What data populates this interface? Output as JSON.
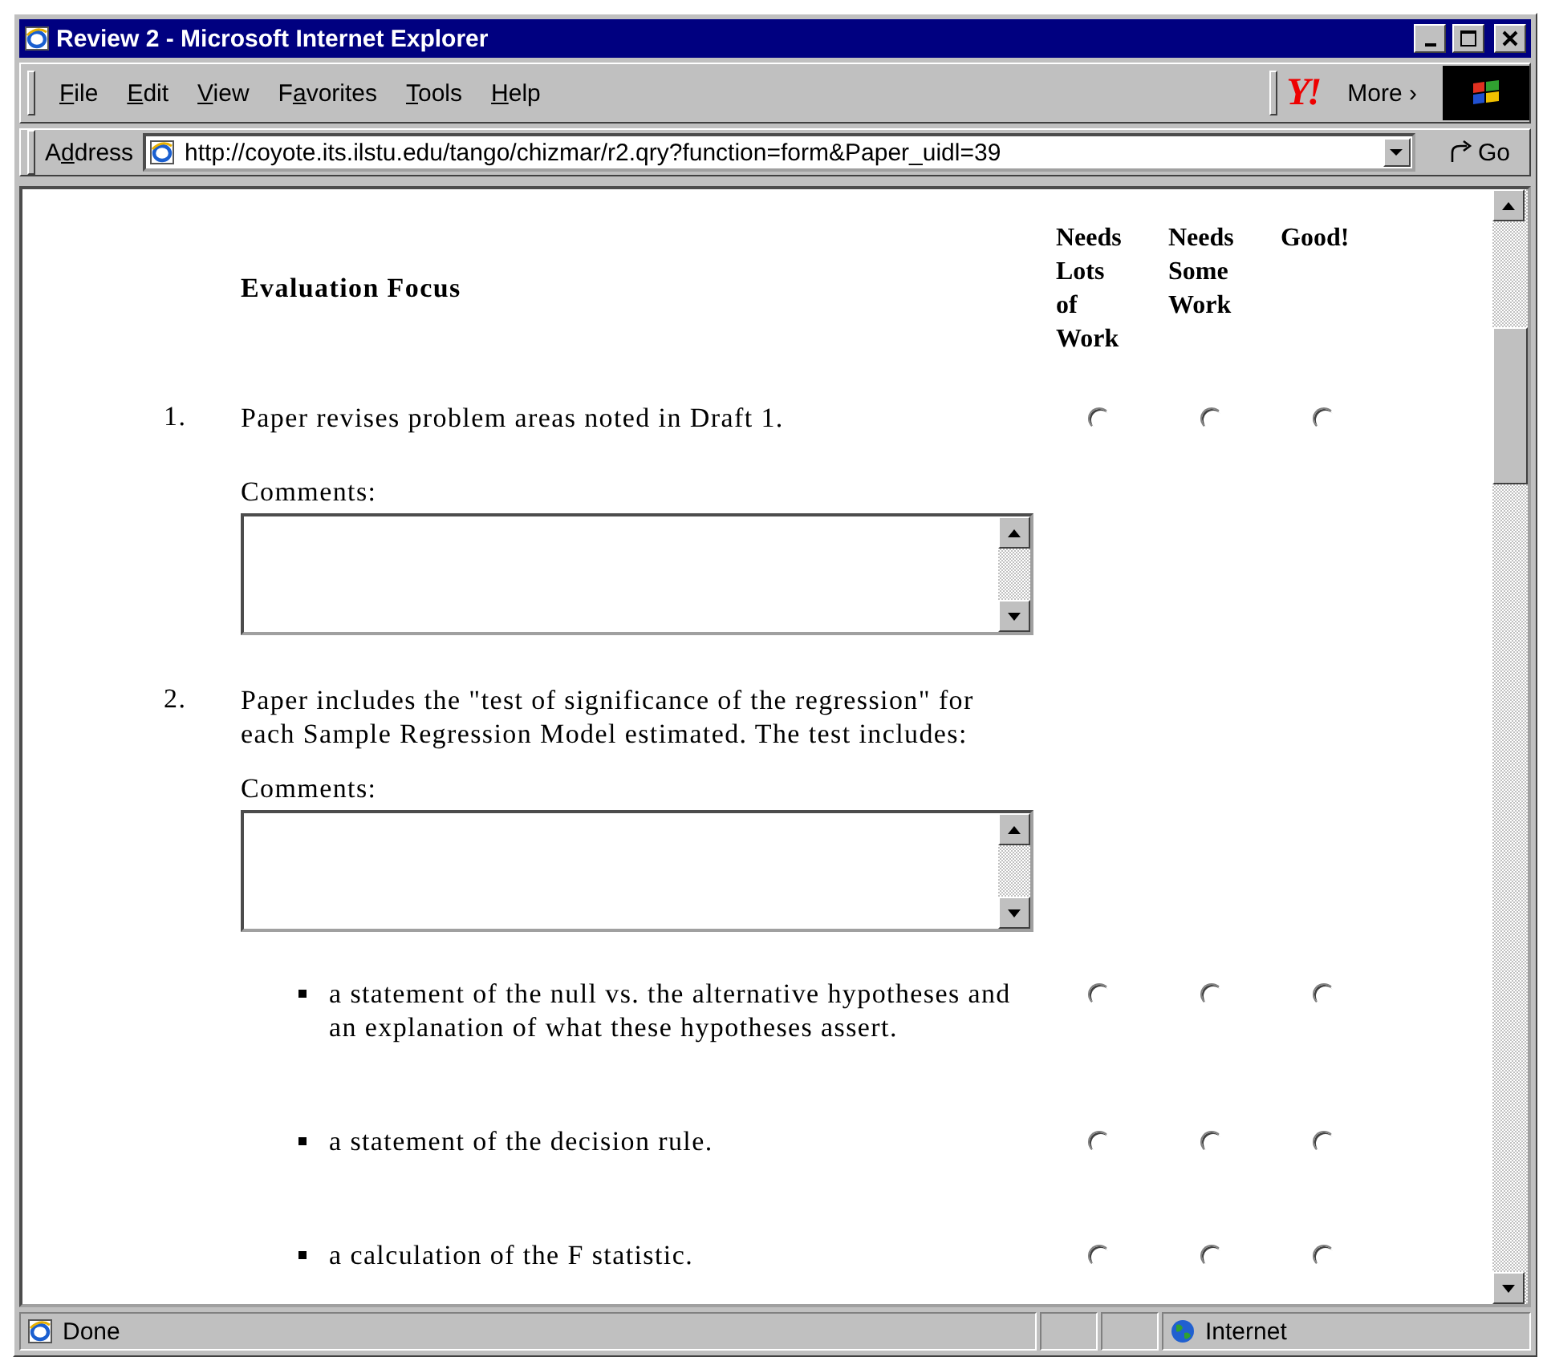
{
  "window": {
    "title": "Review 2 - Microsoft Internet Explorer"
  },
  "menu": [
    {
      "key": "F",
      "after": "ile"
    },
    {
      "key": "E",
      "after": "dit"
    },
    {
      "key": "V",
      "after": "iew"
    },
    {
      "before": "F",
      "key": "a",
      "after": "vorites"
    },
    {
      "key": "T",
      "after": "ools"
    },
    {
      "key": "H",
      "after": "elp"
    }
  ],
  "links": {
    "logo": "Y!",
    "more": "More ›"
  },
  "address": {
    "before": "A",
    "key": "d",
    "after": "dress",
    "url": "http://coyote.its.ilstu.edu/tango/chizmar/r2.qry?function=form&Paper_uidl=39",
    "go": "Go"
  },
  "form": {
    "focus_heading": "Evaluation Focus",
    "rating_headers": [
      "Needs Lots of Work",
      "Needs Some Work",
      "Good!"
    ],
    "items": [
      {
        "number": "1.",
        "text": "Paper revises problem areas noted in Draft 1.",
        "ratings": [
          {
            "selected": false
          },
          {
            "selected": false
          },
          {
            "selected": false
          }
        ],
        "comments_label": "Comments:"
      },
      {
        "number": "2.",
        "text": "Paper includes the \"test of significance of the regression\" for each Sample Regression Model estimated. The test includes:",
        "comments_label": "Comments:",
        "subitems": [
          {
            "text": "a statement of the null vs. the alternative hypotheses and an explanation of what these hypotheses assert.",
            "ratings": [
              {
                "selected": false
              },
              {
                "selected": false
              },
              {
                "selected": false
              }
            ]
          },
          {
            "text": "a statement of the decision rule.",
            "ratings": [
              {
                "selected": false
              },
              {
                "selected": false
              },
              {
                "selected": false
              }
            ]
          },
          {
            "text": "a calculation of the F statistic.",
            "ratings": [
              {
                "selected": false
              },
              {
                "selected": false
              },
              {
                "selected": false
              }
            ]
          }
        ]
      }
    ]
  },
  "status_bar": {
    "status": "Done",
    "zone": "Internet"
  }
}
